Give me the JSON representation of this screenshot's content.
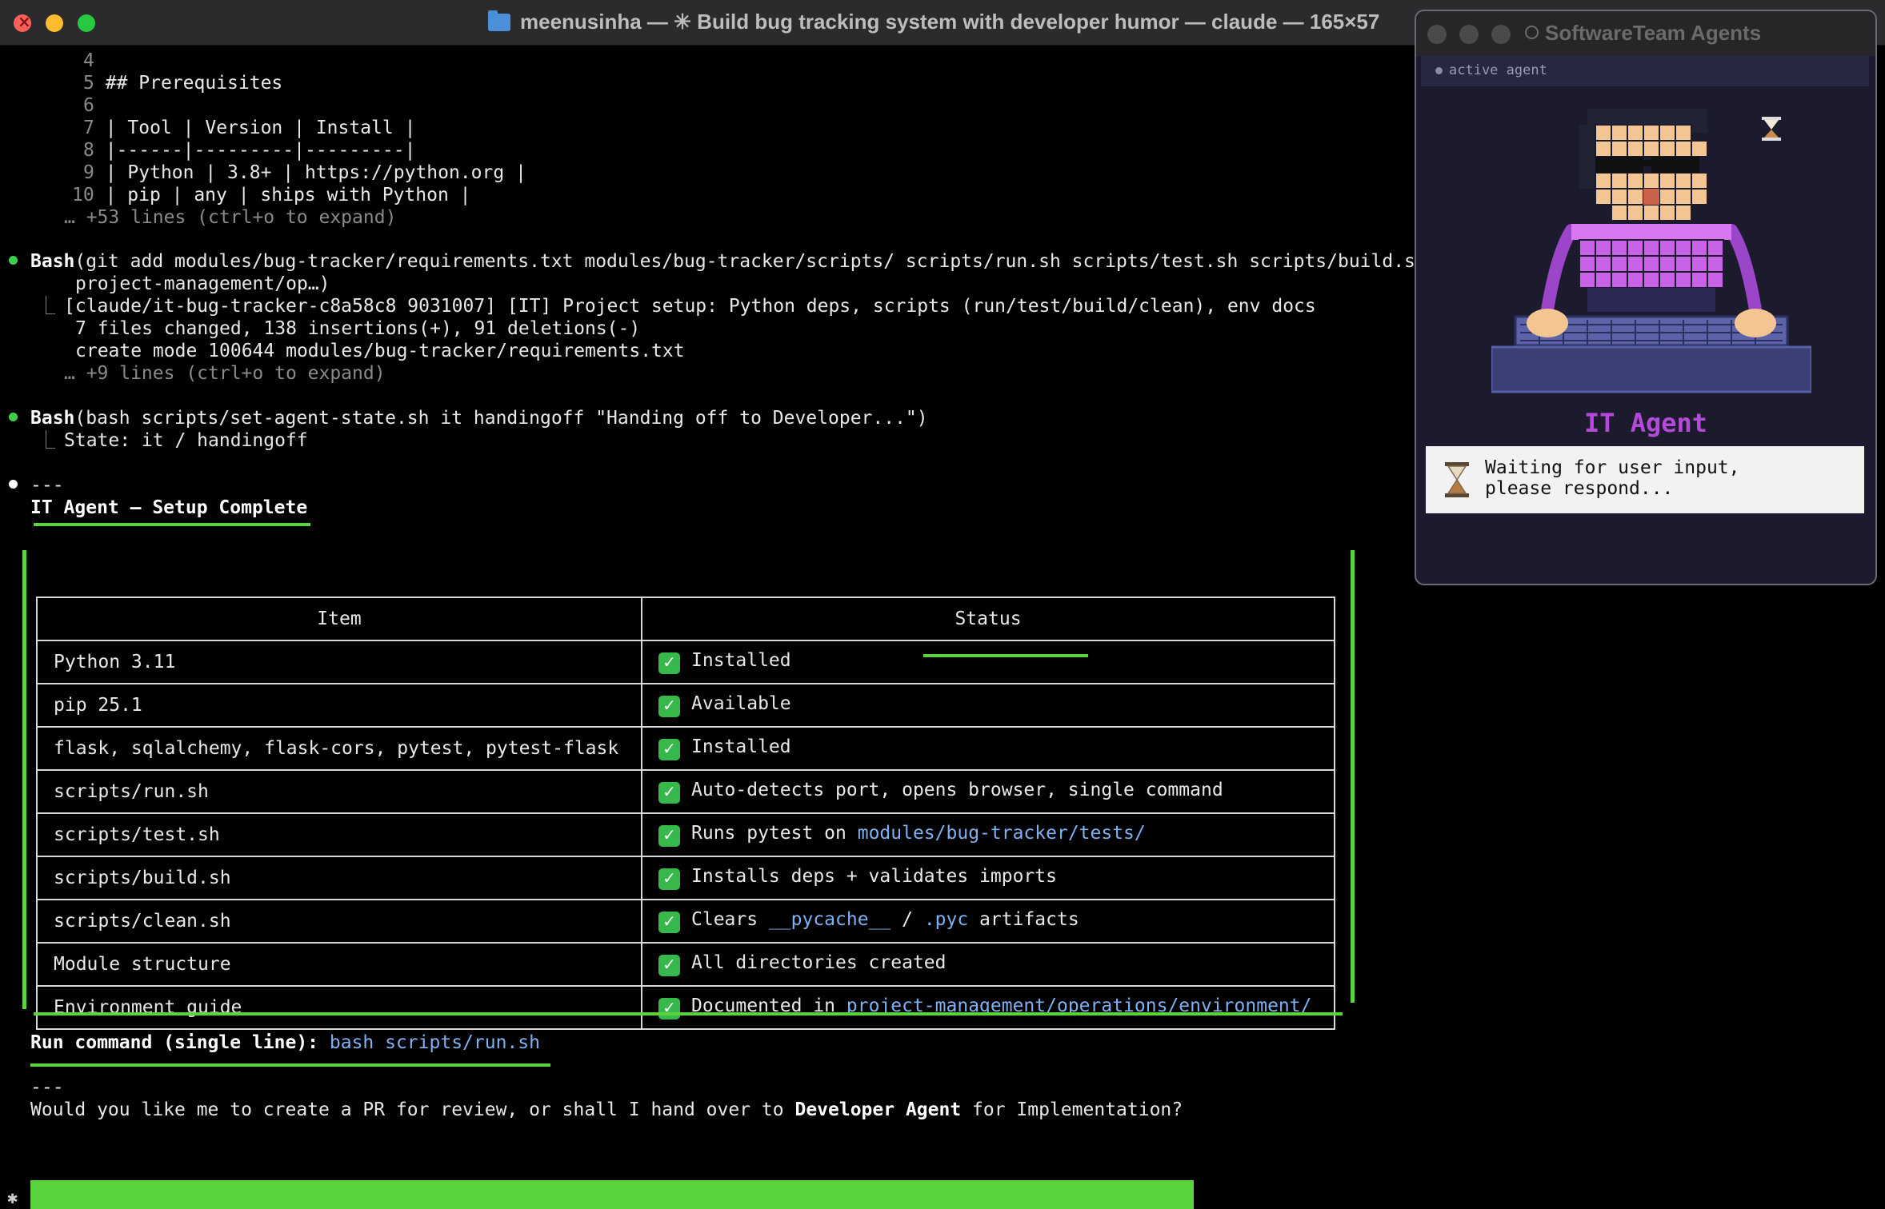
{
  "window": {
    "title": "meenusinha — ✳ Build bug tracking system with developer humor — claude — 165×57"
  },
  "file_preview": {
    "lines": [
      {
        "num": "4",
        "text": ""
      },
      {
        "num": "5",
        "text": "## Prerequisites"
      },
      {
        "num": "6",
        "text": ""
      },
      {
        "num": "7",
        "text": "| Tool | Version | Install |"
      },
      {
        "num": "8",
        "text": "|------|---------|---------|"
      },
      {
        "num": "9",
        "text": "| Python | 3.8+ | https://python.org |"
      },
      {
        "num": "10",
        "text": "| pip | any | ships with Python |"
      }
    ],
    "more": "… +53 lines (ctrl+o to expand)"
  },
  "bash_git": {
    "cmd_name": "Bash",
    "cmd_args": "(git add modules/bug-tracker/requirements.txt modules/bug-tracker/scripts/ scripts/run.sh scripts/test.sh scripts/build.sh scripts/",
    "cmd_args_cont": "project-management/op…)",
    "out1": "[claude/it-bug-tracker-c8a58c8 9031007] [IT] Project setup: Python deps, scripts (run/test/build/clean), env docs",
    "out2": "7 files changed, 138 insertions(+), 91 deletions(-)",
    "out3": "create mode 100644 modules/bug-tracker/requirements.txt",
    "more": "… +9 lines (ctrl+o to expand)"
  },
  "bash_state": {
    "cmd_name": "Bash",
    "cmd_args": "(bash scripts/set-agent-state.sh it handingoff \"Handing off to Developer...\")",
    "out": "State: it / handingoff"
  },
  "summary": {
    "rule": "---",
    "heading": "IT Agent — Setup Complete",
    "table_headers": [
      "Item",
      "Status"
    ],
    "rows": [
      {
        "item": "Python 3.11",
        "status": "Installed"
      },
      {
        "item": "pip 25.1",
        "status": "Available"
      },
      {
        "item": "flask, sqlalchemy, flask-cors, pytest, pytest-flask",
        "status": "Installed"
      },
      {
        "item": "scripts/run.sh",
        "status": "Auto-detects port, opens browser, single command"
      },
      {
        "item": "scripts/test.sh",
        "status_pre": "Runs pytest on ",
        "status_path": "modules/bug-tracker/tests/"
      },
      {
        "item": "scripts/build.sh",
        "status": "Installs deps + validates imports"
      },
      {
        "item": "scripts/clean.sh",
        "status_pre": "Clears ",
        "status_path": "__pycache__",
        "status_mid": " / ",
        "status_path2": ".pyc",
        "status_post": " artifacts"
      },
      {
        "item": "Module structure",
        "status": "All directories created"
      },
      {
        "item": "Environment guide",
        "status_pre": "Documented in ",
        "status_path": "project-management/operations/environment/"
      }
    ],
    "run_label": "Run command (single line): ",
    "run_cmd": "bash scripts/run.sh",
    "rule2": "---",
    "question_pre": "Would you like me to create a PR for review, or shall I hand over to ",
    "question_bold": "Developer Agent",
    "question_post": " for Implementation?"
  },
  "prompt": {
    "marker": "✱"
  },
  "agent_panel": {
    "title": "SoftwareTeam Agents",
    "active_label": "active agent",
    "agent_name": "IT Agent",
    "message": "Waiting for user input,\nplease respond...",
    "icon": "hourglass-icon",
    "colors": {
      "accent": "#b44ad8",
      "check": "#36b84a",
      "highlight": "#5ad43c"
    }
  }
}
